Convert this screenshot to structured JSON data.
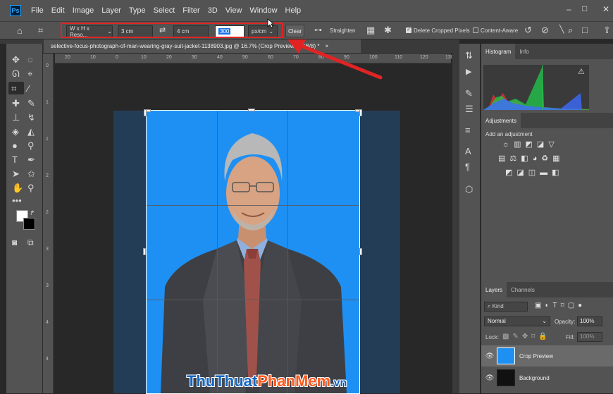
{
  "app": {
    "logo": "Ps"
  },
  "menu": [
    "File",
    "Edit",
    "Image",
    "Layer",
    "Type",
    "Select",
    "Filter",
    "3D",
    "View",
    "Window",
    "Help"
  ],
  "window_controls": {
    "minimize": "–",
    "restore": "□",
    "close": "✕"
  },
  "options": {
    "preset": "W x H x Reso...",
    "width": "3 cm",
    "height": "4 cm",
    "resolution": "300",
    "unit": "px/cm",
    "clear": "Clear",
    "straighten": "Straighten",
    "delete_cropped": "Delete Cropped Pixels",
    "content_aware": "Content-Aware",
    "delete_cropped_checked": true,
    "content_aware_checked": false
  },
  "document_tab": {
    "title": "selective-focus-photograph-of-man-wearing-gray-suit-jacket-1138903.jpg @ 16.7% (Crop Preview, RGB/8) *",
    "close": "×"
  },
  "ruler": {
    "h_ticks": [
      "20",
      "10",
      "0",
      "10",
      "20",
      "30",
      "40",
      "50",
      "60",
      "70",
      "80",
      "90",
      "100",
      "110",
      "120",
      "130"
    ],
    "v_ticks": [
      "0",
      "1",
      "1",
      "2",
      "2",
      "3",
      "3",
      "4",
      "4"
    ]
  },
  "panels": {
    "histogram": {
      "tabs": [
        "Histogram",
        "Info"
      ]
    },
    "adjustments": {
      "tabs": [
        "Adjustments"
      ],
      "hint": "Add an adjustment"
    },
    "layers": {
      "tabs": [
        "Layers",
        "Channels"
      ],
      "kind": "Kind",
      "blend_mode": "Normal",
      "opacity_label": "Opacity:",
      "opacity": "100%",
      "lock_label": "Lock:",
      "fill_label": "Fill:",
      "fill": "100%",
      "items": [
        {
          "name": "Crop Preview"
        },
        {
          "name": "Background"
        }
      ]
    }
  },
  "watermark": {
    "part1": "ThuThuat",
    "part2": "PhanMem",
    "part3": ".vn"
  },
  "colors": {
    "annotation_red": "#e02424",
    "canvas_blue": "#1e90f3",
    "doc_bg": "#243d57"
  }
}
